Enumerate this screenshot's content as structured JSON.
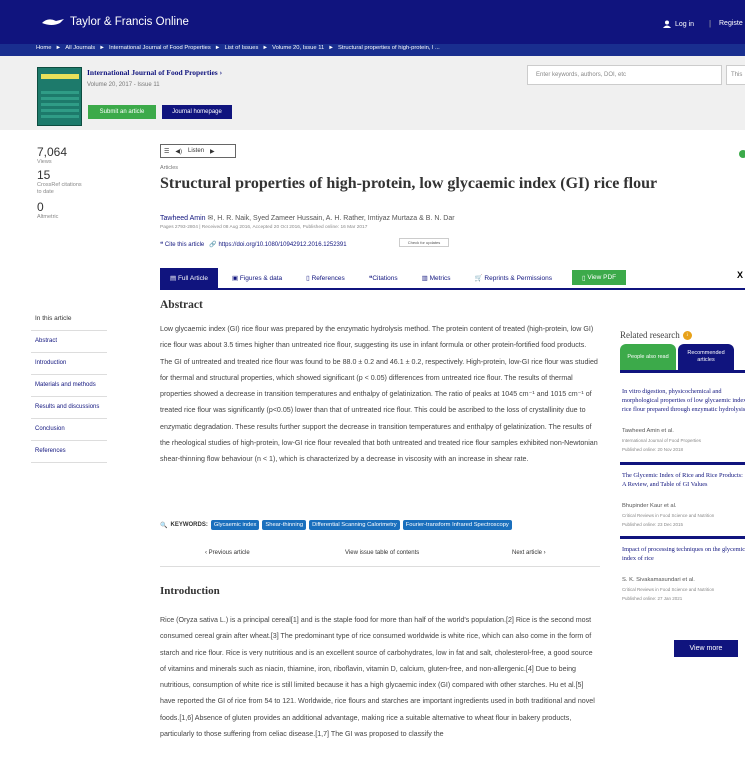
{
  "header": {
    "logo_text": "Taylor & Francis Online",
    "login": "Log in",
    "register": "Registe"
  },
  "breadcrumb": [
    "Home",
    "All Journals",
    "International Journal of Food Properties",
    "List of Issues",
    "Volume 20, Issue 11",
    "Structural properties of high-protein, l ..."
  ],
  "journal": {
    "title": "International Journal of Food Properties",
    "volume": "Volume 20, 2017 - Issue 11",
    "submit": "Submit an article",
    "homepage": "Journal homepage",
    "search_placeholder": "Enter keywords, authors, DOI, etc",
    "search2": "This"
  },
  "metrics": [
    {
      "value": "7,064",
      "label": "Views"
    },
    {
      "value": "15",
      "label": "CrossRef citations to date"
    },
    {
      "value": "0",
      "label": "Altmetric"
    }
  ],
  "article": {
    "listen": "Listen",
    "type": "Articles",
    "title": "Structural properties of high-protein, low glycaemic index (GI) rice flour",
    "first_author": "Tawheed Amin",
    "other_authors": "H. R. Naik, Syed Zameer Hussain, A. H. Rather, Imtiyaz Murtaza & B. N. Dar",
    "pages": "Pages 2793-2804 | Received 08 Aug 2016, Accepted 20 Oct 2016, Published online: 16 Mar 2017",
    "cite": "Cite this article",
    "doi": "https://doi.org/10.1080/10942912.2016.1252391",
    "updates": "Check for updates"
  },
  "tabs": [
    "Full Article",
    "Figures & data",
    "References",
    "Citations",
    "Metrics",
    "Reprints & Permissions",
    "View PDF"
  ],
  "abstract": {
    "heading": "Abstract",
    "text": "Low glycaemic index (GI) rice flour was prepared by the enzymatic hydrolysis method. The protein content of treated (high-protein, low GI) rice flour was about 3.5 times higher than untreated rice flour, suggesting its use in infant formula or other protein-fortified food products. The GI of untreated and treated rice flour was found to be 88.0 ± 0.2 and 46.1 ± 0.2, respectively. High-protein, low-GI rice flour was studied for thermal and structural properties, which showed significant (p < 0.05) differences from untreated rice flour. The results of thermal properties showed a decrease in transition temperatures and enthalpy of gelatinization. The ratio of peaks at 1045 cm⁻¹ and 1015 cm⁻¹ of treated rice flour was significantly (p<0.05) lower than that of untreated rice flour. This could be ascribed to the loss of crystallinity due to enzymatic degradation. These results further support the decrease in transition temperatures and enthalpy of gelatinization. The results of the rheological studies of high-protein, low-GI rice flour revealed that both untreated and treated rice flour samples exhibited non-Newtonian shear-thinning flow behaviour (n < 1), which is characterized by a decrease in viscosity with an increase in shear rate."
  },
  "keywords": {
    "label": "KEYWORDS:",
    "items": [
      "Glycaemic index",
      "Shear-thinning",
      "Differential Scanning Calorimetry",
      "Fourier-transform Infrared Spectroscopy"
    ]
  },
  "nav": {
    "prev": "Previous article",
    "view": "View issue table of contents",
    "next": "Next article"
  },
  "intro": {
    "heading": "Introduction",
    "text": "Rice (Oryza sativa L.) is a principal cereal[1] and is the staple food for more than half of the world's population.[2] Rice is the second most consumed cereal grain after wheat.[3] The predominant type of rice consumed worldwide is white rice, which can also come in the form of starch and rice flour. Rice is very nutritious and is an excellent source of carbohydrates, low in fat and salt, cholesterol-free, a good source of vitamins and minerals such as niacin, thiamine, iron, riboflavin, vitamin D, calcium, gluten-free, and non-allergenic.[4] Due to being nutritious, consumption of white rice is still limited because it has a high glycaemic index (GI) compared with other starches. Hu et al.[5] have reported the GI of rice from 54 to 121. Worldwide, rice flours and starches are important ingredients used in both traditional and novel foods.[1,6] Absence of gluten provides an additional advantage, making rice a suitable alternative to wheat flour in bakery products, particularly to those suffering from celiac disease.[1,7] The GI was proposed to classify the"
  },
  "sidebar": {
    "heading": "In this article",
    "items": [
      "Abstract",
      "Introduction",
      "Materials and methods",
      "Results and discussions",
      "Conclusion",
      "References"
    ]
  },
  "related": {
    "heading": "Related research",
    "tabs": [
      "People also read",
      "Recommended articles"
    ],
    "cards": [
      {
        "title": "In vitro digestion, physicochemical and morphological properties of low glycaemic index rice flour prepared through enzymatic hydrolysis",
        "author": "Tawheed Amin et al.",
        "source": "International Journal of Food Properties",
        "date": "Published online: 20 Nov 2018"
      },
      {
        "title": "The Glycemic Index of Rice and Rice Products: A Review, and Table of GI Values",
        "author": "Bhupinder Kaur et al.",
        "source": "Critical Reviews in Food Science and Nutrition",
        "date": "Published online: 23 Dec 2015"
      },
      {
        "title": "Impact of processing techniques on the glycemic index of rice",
        "author": "S. K. Sivakamasundari et al.",
        "source": "Critical Reviews in Food Science and Nutrition",
        "date": "Published online: 27 Jan 2021"
      }
    ],
    "view_more": "View more"
  }
}
